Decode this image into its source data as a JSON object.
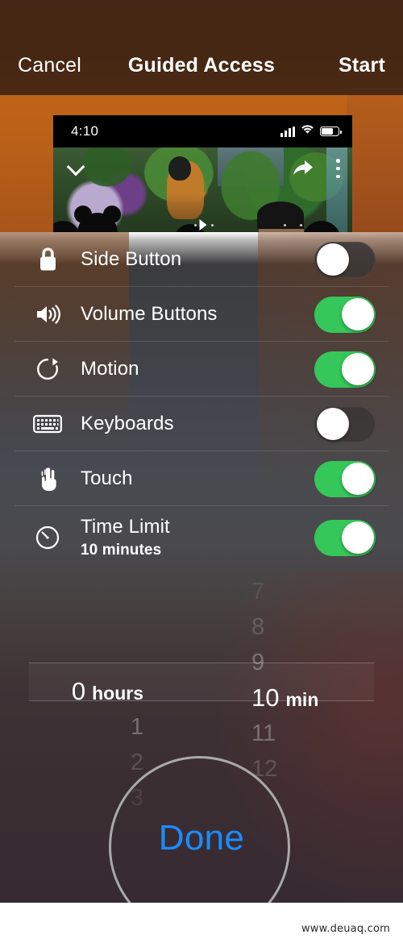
{
  "navbar": {
    "cancel_label": "Cancel",
    "title": "Guided Access",
    "start_label": "Start"
  },
  "preview": {
    "status": {
      "time": "4:10",
      "signal_icon": "cellular-signal-icon",
      "wifi_icon": "wifi-icon",
      "battery_icon": "battery-icon"
    },
    "controls": {
      "collapse_icon": "chevron-down-icon",
      "share_icon": "share-arrow-icon",
      "more_icon": "kebab-menu-icon",
      "play_icon": "play-triangle-icon"
    }
  },
  "settings": {
    "rows": [
      {
        "icon": "lock-icon",
        "label": "Side Button",
        "sub": "",
        "enabled": false
      },
      {
        "icon": "speaker-icon",
        "label": "Volume Buttons",
        "sub": "",
        "enabled": true
      },
      {
        "icon": "rotate-icon",
        "label": "Motion",
        "sub": "",
        "enabled": true
      },
      {
        "icon": "keyboard-icon",
        "label": "Keyboards",
        "sub": "",
        "enabled": false
      },
      {
        "icon": "touch-hand-icon",
        "label": "Touch",
        "sub": "",
        "enabled": true
      },
      {
        "icon": "timer-icon",
        "label": "Time Limit",
        "sub": "10 minutes",
        "enabled": true
      }
    ]
  },
  "picker": {
    "hours": {
      "above": [
        "",
        "",
        ""
      ],
      "selected_value": "0",
      "selected_unit": "hours",
      "below": [
        "1",
        "2",
        "3"
      ]
    },
    "minutes": {
      "above": [
        "7",
        "8",
        "9"
      ],
      "selected_value": "10",
      "selected_unit": "min",
      "below": [
        "11",
        "12",
        ""
      ]
    }
  },
  "done": {
    "label": "Done",
    "highlight_ring": "tap-highlight-circle"
  },
  "watermark": {
    "text": "www.deuaq.com"
  },
  "colors": {
    "toggle_on": "#35c759",
    "done_blue": "#1a8cff",
    "navbar": "#452713",
    "app_orange": "#bc6217"
  }
}
